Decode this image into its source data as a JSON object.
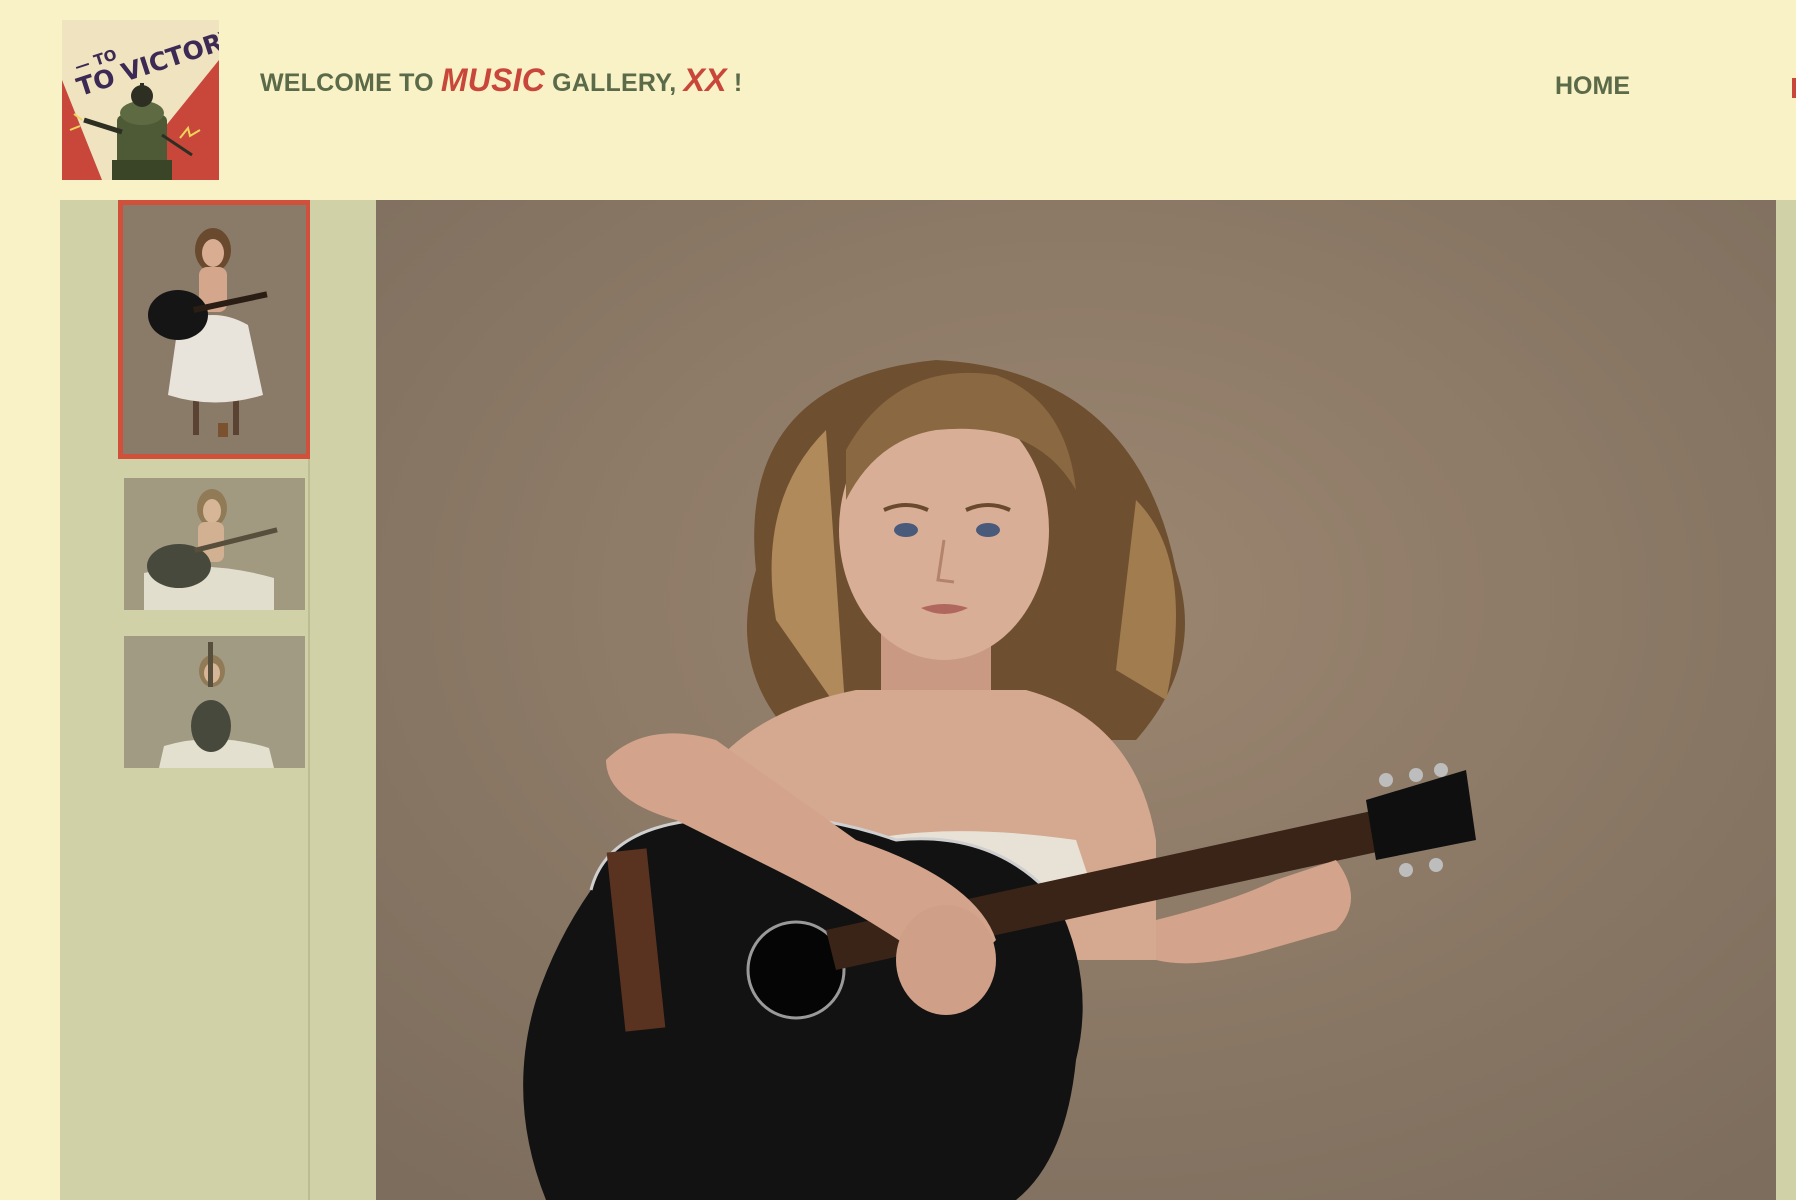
{
  "header": {
    "logo": {
      "text": "TO VICTORY!",
      "icon": "dalek-poster-logo"
    },
    "welcome": {
      "prefix": "WELCOME TO ",
      "gallery_name": "MUSIC",
      "middle": " GALLERY, ",
      "user_name": "XX",
      "suffix": " !"
    },
    "nav": [
      {
        "label": "HOME"
      }
    ]
  },
  "gallery": {
    "thumbnails": [
      {
        "label": "girl-seated-stool-guitar",
        "active": true
      },
      {
        "label": "girl-seated-guitar-landscape",
        "active": false
      },
      {
        "label": "girl-floor-upright-guitar",
        "active": false
      }
    ],
    "main_image": {
      "label": "girl-with-black-acoustic-guitar"
    }
  },
  "colors": {
    "background": "#f9f2c6",
    "sidebar": "#d0d1a6",
    "text_green": "#5b6a48",
    "accent_red": "#c8473a"
  }
}
